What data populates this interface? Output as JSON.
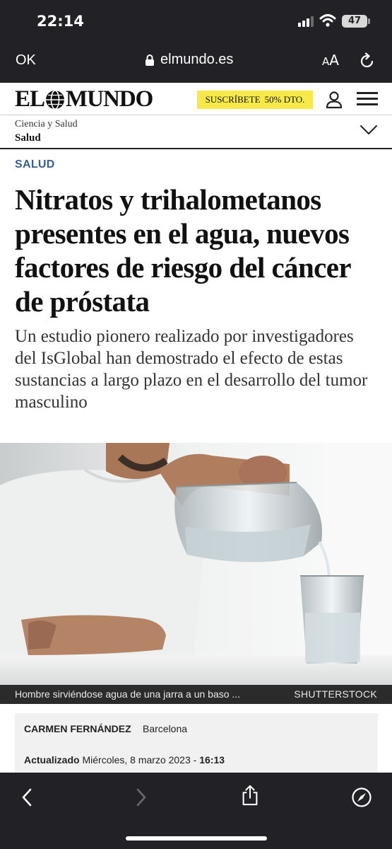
{
  "status_bar": {
    "time": "22:14",
    "battery": "47"
  },
  "browser": {
    "done_label": "OK",
    "url": "elmundo.es",
    "text_size_small": "A",
    "text_size_large": "A"
  },
  "site": {
    "logo_left": "EL",
    "logo_right": "MUNDO",
    "subscribe_label": "SUSCRÍBETE",
    "subscribe_discount": "50% DTO."
  },
  "breadcrumb": {
    "parent": "Ciencia y Salud",
    "current": "Salud"
  },
  "article": {
    "section": "SALUD",
    "headline": "Nitratos y trihalometanos presentes en el agua, nuevos factores de riesgo del cáncer de próstata",
    "subheadline": "Un estudio pionero realizado por investigadores del IsGlobal han demostrado el efecto de estas sustancias a largo plazo en el desarrollo del tumor masculino",
    "caption": "Hombre sirviéndose agua de una jarra a un baso ...",
    "photo_credit": "SHUTTERSTOCK",
    "author": "CARMEN FERNÁNDEZ",
    "location": "Barcelona",
    "updated_label": "Actualizado",
    "updated_date": "Miércoles, 8 marzo 2023 - ",
    "updated_time": "16:13"
  },
  "colors": {
    "chrome": "#222226",
    "subscribe_bg": "#f7e94a",
    "section_tag": "#3a5f8a"
  }
}
